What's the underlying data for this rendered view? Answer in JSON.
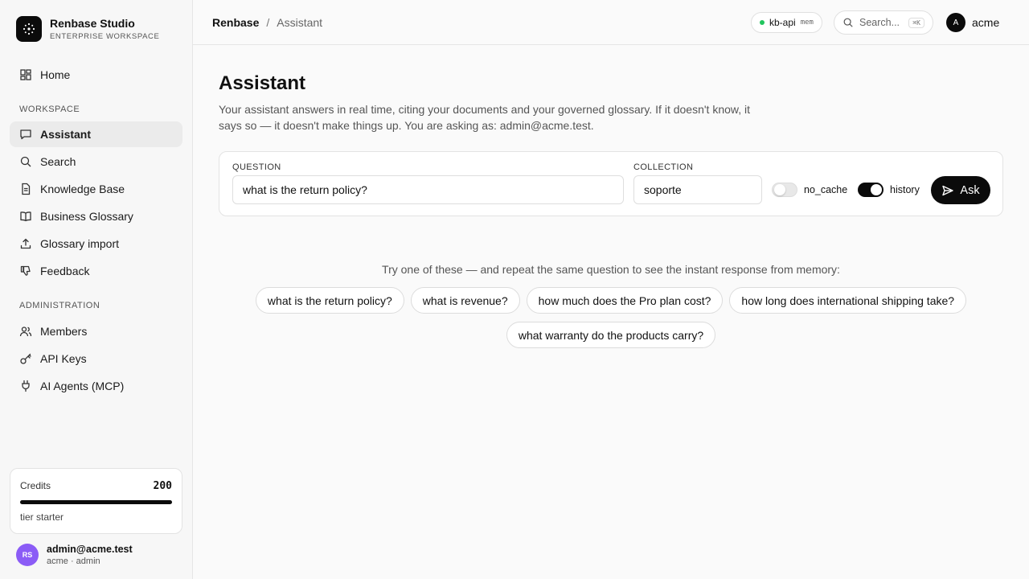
{
  "brand": {
    "name": "Renbase Studio",
    "subtitle": "ENTERPRISE WORKSPACE"
  },
  "nav": {
    "home": "Home",
    "workspace_label": "WORKSPACE",
    "workspace": [
      "Assistant",
      "Search",
      "Knowledge Base",
      "Business Glossary",
      "Glossary import",
      "Feedback"
    ],
    "admin_label": "ADMINISTRATION",
    "admin": [
      "Members",
      "API Keys",
      "AI Agents (MCP)"
    ]
  },
  "credits": {
    "label": "Credits",
    "value": "200",
    "progress": 1.0,
    "tier": "tier starter"
  },
  "user": {
    "initials": "RS",
    "email": "admin@acme.test",
    "role": "acme · admin"
  },
  "breadcrumb": {
    "root": "Renbase",
    "separator": "/",
    "current": "Assistant"
  },
  "status": {
    "name": "kb-api",
    "mode": "mem",
    "color": "#22c55e"
  },
  "search": {
    "placeholder": "Search...",
    "shortcut": "⌘K"
  },
  "org": {
    "initial": "A",
    "name": "acme"
  },
  "page": {
    "title": "Assistant",
    "description": "Your assistant answers in real time, citing your documents and your governed glossary. If it doesn't know, it says so — it doesn't make things up. You are asking as: admin@acme.test."
  },
  "form": {
    "question_label": "QUESTION",
    "question_value": "what is the return policy?",
    "collection_label": "COLLECTION",
    "collection_value": "soporte",
    "no_cache_label": "no_cache",
    "no_cache_on": false,
    "history_label": "history",
    "history_on": true,
    "ask_label": "Ask"
  },
  "suggestions": {
    "hint": "Try one of these — and repeat the same question to see the instant response from memory:",
    "items": [
      "what is the return policy?",
      "what is revenue?",
      "how much does the Pro plan cost?",
      "how long does international shipping take?",
      "what warranty do the products carry?"
    ]
  },
  "colors": {
    "accent": "#0b0b0b",
    "avatar": "#8b5cf6",
    "status": "#22c55e"
  }
}
